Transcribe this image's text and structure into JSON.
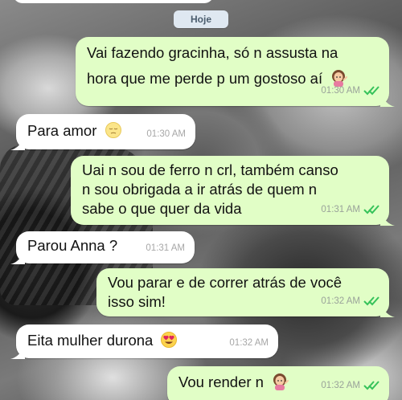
{
  "date_separator": "Hoje",
  "messages": [
    {
      "side": "out",
      "lines": [
        "Vai fazendo gracinha, só n assusta na",
        "hora que me perde p um gostoso aí"
      ],
      "emoji": "information-desk-person-emoji",
      "time": "01:30 AM",
      "status": "read-double-check"
    },
    {
      "side": "in",
      "lines": [
        "Para amor"
      ],
      "emoji": "sleepy-face-emoji",
      "time": "01:30 AM"
    },
    {
      "side": "out",
      "lines": [
        "Uai n sou de ferro n crl, também canso",
        "n sou obrigada a ir atrás de quem n",
        "sabe o que quer da vida"
      ],
      "time": "01:31 AM",
      "status": "read-double-check"
    },
    {
      "side": "in",
      "lines": [
        "Parou Anna ?"
      ],
      "time": "01:31 AM"
    },
    {
      "side": "out",
      "lines": [
        "Vou parar e de correr atrás de você",
        "isso sim!"
      ],
      "time": "01:32 AM",
      "status": "read-double-check"
    },
    {
      "side": "in",
      "lines": [
        "Eita mulher durona"
      ],
      "emoji": "heart-eyes-emoji",
      "time": "01:32 AM"
    },
    {
      "side": "out",
      "lines": [
        "Vou render n"
      ],
      "emoji": "information-desk-person-emoji",
      "time": "01:32 AM",
      "status": "read-double-check"
    }
  ],
  "colors": {
    "incoming_bubble": "#ffffff",
    "outgoing_bubble": "#e1fec6",
    "read_ticks": "#36c25a",
    "date_chip": "#dfe8f1"
  }
}
